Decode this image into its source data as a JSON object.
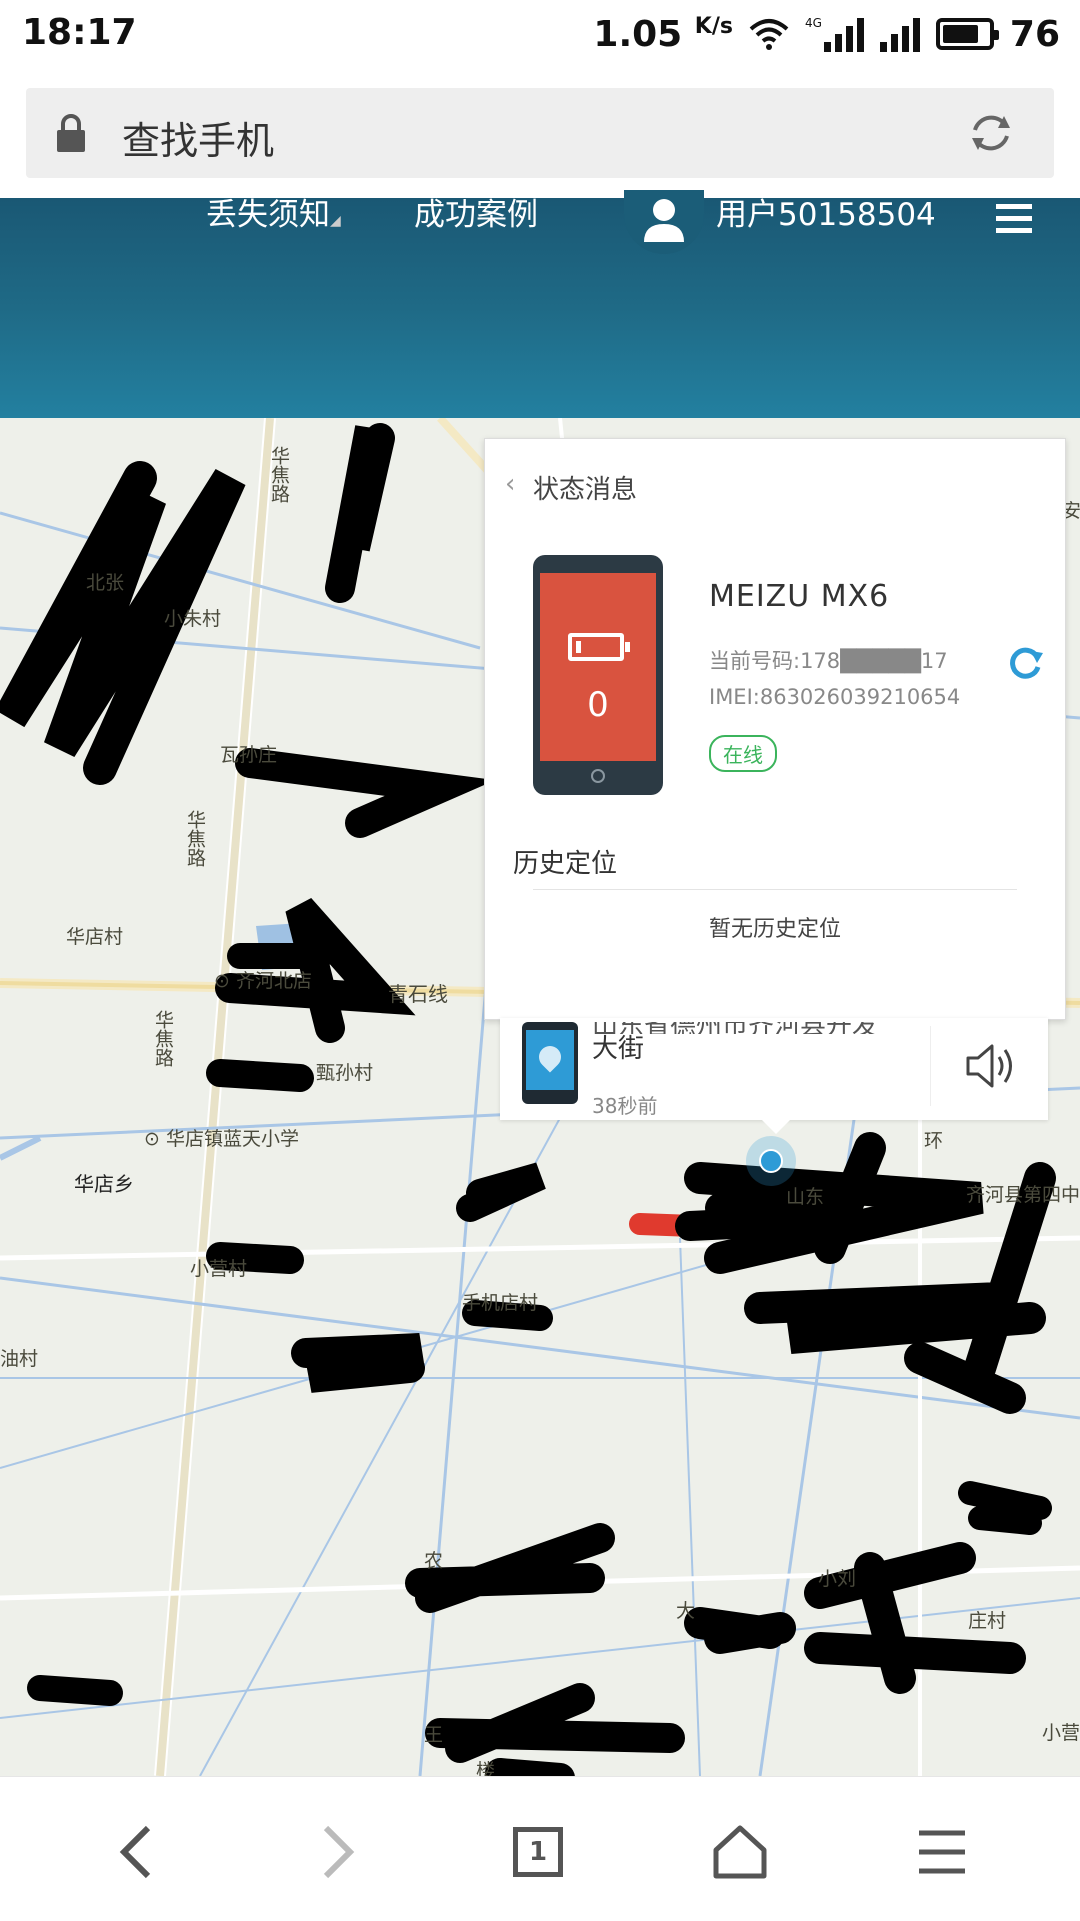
{
  "status_bar": {
    "time": "18:17",
    "net_speed": "1.05",
    "net_unit": "K/s",
    "network_type": "4G",
    "battery_level": "76"
  },
  "url_bar": {
    "title": "查找手机"
  },
  "header": {
    "nav": [
      "丢失须知",
      "成功案例"
    ],
    "username": "用户50158504"
  },
  "status_panel": {
    "title": "状态消息",
    "device_name": "MEIZU MX6",
    "phone_number": "当前号码:178█████17",
    "imei": "IMEI:863026039210654",
    "online_badge": "在线",
    "battery_value": "0",
    "history_title": "历史定位",
    "history_empty": "暂无历史定位"
  },
  "location_card": {
    "address_line1": "山东省德州市齐河县开发",
    "address_line2": "大街",
    "time_ago": "38秒前"
  },
  "map": {
    "labels": [
      {
        "id": "huajiao-1",
        "text": "华焦路"
      },
      {
        "id": "beizhang",
        "text": "北张"
      },
      {
        "id": "xiaozhu",
        "text": "小朱村"
      },
      {
        "id": "wabu",
        "text": "瓦孙庄"
      },
      {
        "id": "huajiao-2",
        "text": "华焦路"
      },
      {
        "id": "huadian-cun",
        "text": "华店村"
      },
      {
        "id": "qinghe",
        "text": "齐河北店"
      },
      {
        "id": "qingshi",
        "text": "青石线"
      },
      {
        "id": "huajiao-3",
        "text": "华焦路"
      },
      {
        "id": "sunzhuang",
        "text": "甄孙村"
      },
      {
        "id": "school",
        "text": "华店镇蓝天小学"
      },
      {
        "id": "huadian-xiang",
        "text": "华店乡"
      },
      {
        "id": "xiaoyuan",
        "text": "小营村"
      },
      {
        "id": "youcun",
        "text": "油村"
      },
      {
        "id": "shou",
        "text": "手机店村"
      },
      {
        "id": "huan",
        "text": "环"
      },
      {
        "id": "school4",
        "text": "齐河县第四中"
      },
      {
        "id": "shandong",
        "text": "山东"
      },
      {
        "id": "nong",
        "text": "农"
      },
      {
        "id": "xiaoliu",
        "text": "小刘"
      },
      {
        "id": "da",
        "text": "大"
      },
      {
        "id": "zhuang",
        "text": "庄村"
      },
      {
        "id": "wang",
        "text": "王"
      },
      {
        "id": "lou",
        "text": "楼"
      },
      {
        "id": "xiaoying2",
        "text": "小营"
      },
      {
        "id": "an",
        "text": "安"
      }
    ]
  },
  "colors": {
    "header_top": "#1a5874",
    "header_bottom": "#2380a0",
    "phone_screen": "#d9533f",
    "online_green": "#3bb45c",
    "marker_blue": "#2e9bd6",
    "refresh_blue": "#2e9bd6"
  },
  "icons": {
    "url_lock": "lock-icon",
    "url_refresh": "refresh-icon",
    "menu": "hamburger-icon",
    "user": "user-icon",
    "back": "chevron-left-icon",
    "speaker": "speaker-icon",
    "nav": [
      "back-arrow-icon",
      "forward-arrow-icon",
      "tabs-icon",
      "home-icon",
      "menu-icon"
    ]
  },
  "bottom_nav": {
    "tab_count": "1"
  }
}
